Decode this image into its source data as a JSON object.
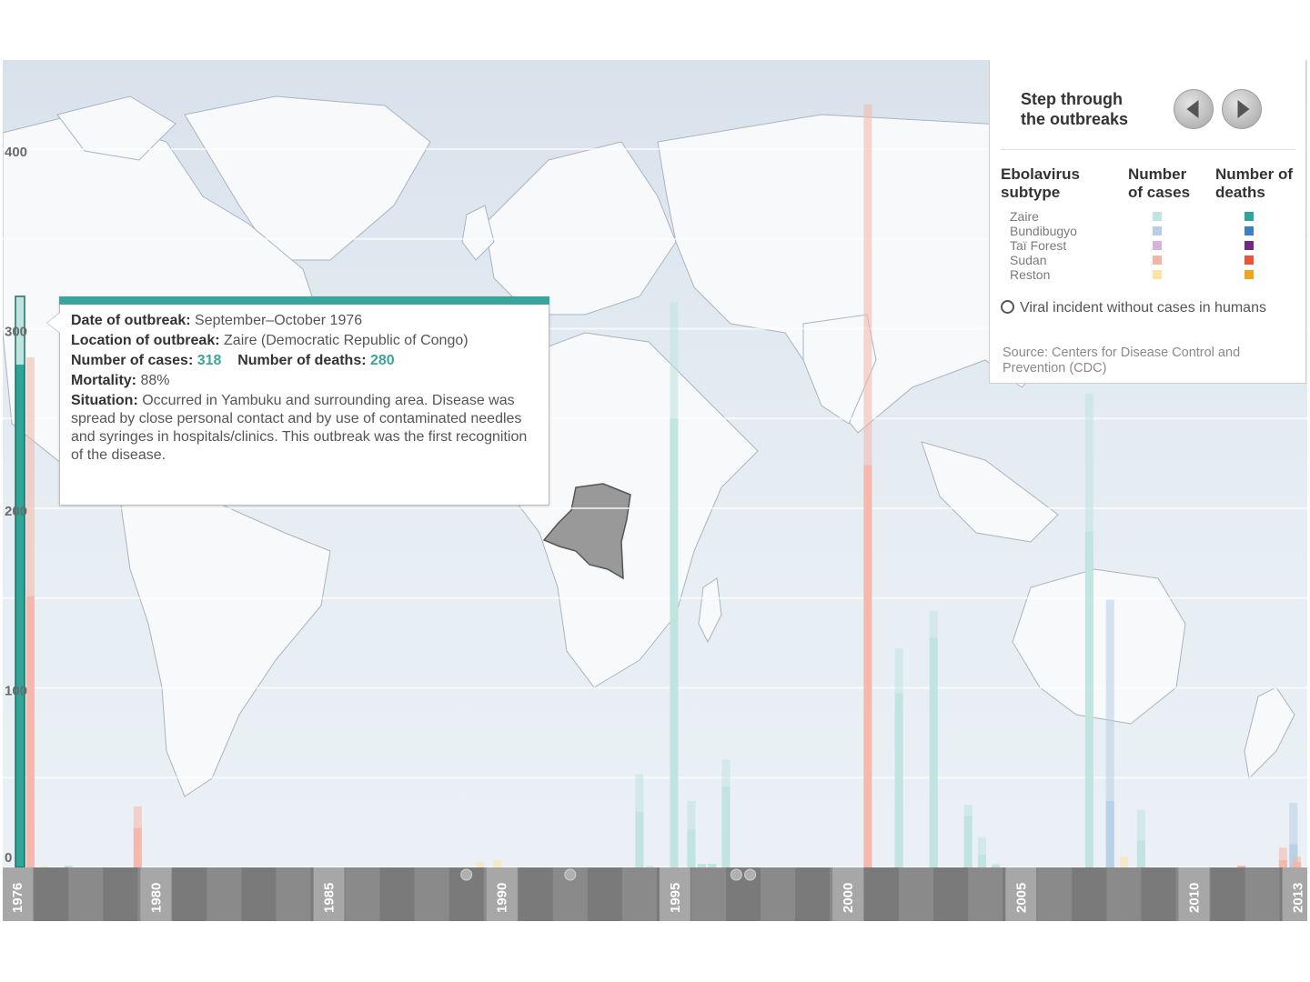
{
  "nav": {
    "step_label": "Step through the outbreaks"
  },
  "legend": {
    "head_subtype": "Ebolavirus subtype",
    "head_cases": "Number of cases",
    "head_deaths": "Number of deaths",
    "subtypes": [
      {
        "name": "Zaire",
        "case_color": "#bfe3df",
        "death_color": "#2ea597"
      },
      {
        "name": "Bundibugyo",
        "case_color": "#b7cfe6",
        "death_color": "#3d7fc4"
      },
      {
        "name": "Taï Forest",
        "case_color": "#d6b3d8",
        "death_color": "#6e2a84"
      },
      {
        "name": "Sudan",
        "case_color": "#f4b6a8",
        "death_color": "#e8533a"
      },
      {
        "name": "Reston",
        "case_color": "#fbe3a3",
        "death_color": "#f2a51a"
      }
    ],
    "viral_incident": "Viral incident without cases in humans",
    "source": "Source: Centers for Disease Control and Prevention (CDC)"
  },
  "tooltip": {
    "date_label": "Date of outbreak:",
    "date_value": "September–October 1976",
    "location_label": "Location of outbreak:",
    "location_value": "Zaire (Democratic Republic of Congo)",
    "cases_label": "Number of cases:",
    "cases_value": "318",
    "deaths_label": "Number of deaths:",
    "deaths_value": "280",
    "mortality_label": "Mortality:",
    "mortality_value": "88%",
    "situation_label": "Situation:",
    "situation_value": "Occurred in Yambuku and surrounding area. Disease was spread by close personal contact and by use of contaminated needles and syringes in hospitals/clinics. This outbreak was the first recognition of the disease."
  },
  "chart_data": {
    "type": "bar",
    "ylim": [
      0,
      425
    ],
    "yticks": [
      "0",
      "100",
      "200",
      "300",
      "400"
    ],
    "xlim": [
      1975.6,
      2013.3
    ],
    "x_tick_labels": [
      "1976",
      "1980",
      "1985",
      "1990",
      "1995",
      "2000",
      "2005",
      "2010",
      "2013"
    ],
    "x_tick_values": [
      1976,
      1980,
      1985,
      1990,
      1995,
      2000,
      2005,
      2010,
      2013
    ],
    "grid": true,
    "selected_outbreak": "Zaire 1976",
    "outbreaks": [
      {
        "x": 1976.1,
        "subtype": "Zaire",
        "cases": 318,
        "deaths": 280,
        "selected": true
      },
      {
        "x": 1976.4,
        "subtype": "Sudan",
        "cases": 284,
        "deaths": 151
      },
      {
        "x": 1976.8,
        "subtype": "Reston",
        "cases": 1,
        "deaths": 0
      },
      {
        "x": 1977.5,
        "subtype": "Zaire",
        "cases": 1,
        "deaths": 1
      },
      {
        "x": 1979.5,
        "subtype": "Sudan",
        "cases": 34,
        "deaths": 22
      },
      {
        "x": 1989.4,
        "subtype": "Reston",
        "cases": 3,
        "deaths": 0
      },
      {
        "x": 1989.9,
        "subtype": "Reston",
        "cases": 4,
        "deaths": 0
      },
      {
        "x": 1994.0,
        "subtype": "Zaire",
        "cases": 52,
        "deaths": 31
      },
      {
        "x": 1994.3,
        "subtype": "Zaire",
        "cases": 1,
        "deaths": 0
      },
      {
        "x": 1995.0,
        "subtype": "Zaire",
        "cases": 315,
        "deaths": 250
      },
      {
        "x": 1995.5,
        "subtype": "Zaire",
        "cases": 37,
        "deaths": 21
      },
      {
        "x": 1995.8,
        "subtype": "Zaire",
        "cases": 2,
        "deaths": 2
      },
      {
        "x": 1996.1,
        "subtype": "Zaire",
        "cases": 2,
        "deaths": 2
      },
      {
        "x": 1996.5,
        "subtype": "Zaire",
        "cases": 60,
        "deaths": 45
      },
      {
        "x": 2000.6,
        "subtype": "Sudan",
        "cases": 425,
        "deaths": 224
      },
      {
        "x": 2001.5,
        "subtype": "Zaire",
        "cases": 122,
        "deaths": 97
      },
      {
        "x": 2002.5,
        "subtype": "Zaire",
        "cases": 143,
        "deaths": 128
      },
      {
        "x": 2003.5,
        "subtype": "Zaire",
        "cases": 35,
        "deaths": 29
      },
      {
        "x": 2003.9,
        "subtype": "Zaire",
        "cases": 17,
        "deaths": 7
      },
      {
        "x": 2004.3,
        "subtype": "Zaire",
        "cases": 2,
        "deaths": 1
      },
      {
        "x": 2007.0,
        "subtype": "Zaire",
        "cases": 264,
        "deaths": 187
      },
      {
        "x": 2007.6,
        "subtype": "Bundibugyo",
        "cases": 149,
        "deaths": 37
      },
      {
        "x": 2008.0,
        "subtype": "Reston",
        "cases": 6,
        "deaths": 0
      },
      {
        "x": 2008.5,
        "subtype": "Zaire",
        "cases": 32,
        "deaths": 15
      },
      {
        "x": 2011.4,
        "subtype": "Sudan",
        "cases": 1,
        "deaths": 1
      },
      {
        "x": 2012.6,
        "subtype": "Sudan",
        "cases": 11,
        "deaths": 4
      },
      {
        "x": 2012.9,
        "subtype": "Bundibugyo",
        "cases": 36,
        "deaths": 13
      },
      {
        "x": 2013.0,
        "subtype": "Sudan",
        "cases": 6,
        "deaths": 3
      }
    ],
    "viral_incidents_x": [
      1989.0,
      1992.0,
      1996.8,
      1997.2
    ],
    "highlighted_country": "Democratic Republic of Congo"
  }
}
